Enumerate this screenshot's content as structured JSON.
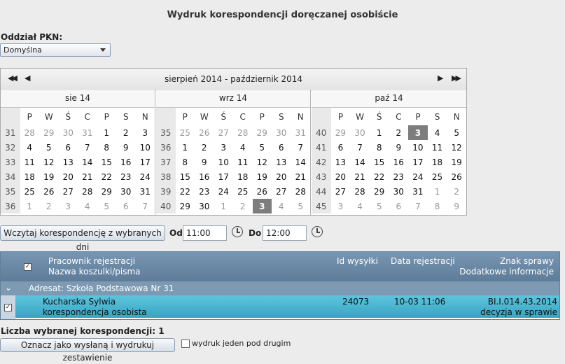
{
  "page": {
    "title": "Wydruk korespondencji doręczanej osobiście"
  },
  "branch": {
    "label": "Oddział PKN:",
    "selected": "Domyślna"
  },
  "calendar": {
    "range_label": "sierpień 2014 - październik 2014",
    "nav": {
      "first": "◀◀",
      "prev": "◀",
      "next": "▶",
      "last": "▶▶"
    },
    "weekdays": [
      "P",
      "W",
      "Ś",
      "C",
      "P",
      "S",
      "N"
    ],
    "months": [
      {
        "title": "sie 14",
        "weeks": [
          {
            "wk": "31",
            "days": [
              [
                "28",
                "o"
              ],
              [
                "29",
                "o"
              ],
              [
                "30",
                "o"
              ],
              [
                "31",
                "o"
              ],
              [
                "1",
                "c"
              ],
              [
                "2",
                "c"
              ],
              [
                "3",
                "c"
              ]
            ]
          },
          {
            "wk": "32",
            "days": [
              [
                "4",
                "c"
              ],
              [
                "5",
                "c"
              ],
              [
                "6",
                "c"
              ],
              [
                "7",
                "c"
              ],
              [
                "8",
                "c"
              ],
              [
                "9",
                "c"
              ],
              [
                "10",
                "c"
              ]
            ]
          },
          {
            "wk": "33",
            "days": [
              [
                "11",
                "c"
              ],
              [
                "12",
                "c"
              ],
              [
                "13",
                "c"
              ],
              [
                "14",
                "c"
              ],
              [
                "15",
                "c"
              ],
              [
                "16",
                "c"
              ],
              [
                "17",
                "c"
              ]
            ]
          },
          {
            "wk": "34",
            "days": [
              [
                "18",
                "c"
              ],
              [
                "19",
                "c"
              ],
              [
                "20",
                "c"
              ],
              [
                "21",
                "c"
              ],
              [
                "22",
                "c"
              ],
              [
                "23",
                "c"
              ],
              [
                "24",
                "c"
              ]
            ]
          },
          {
            "wk": "35",
            "days": [
              [
                "25",
                "c"
              ],
              [
                "26",
                "c"
              ],
              [
                "27",
                "c"
              ],
              [
                "28",
                "c"
              ],
              [
                "29",
                "c"
              ],
              [
                "30",
                "c"
              ],
              [
                "31",
                "c"
              ]
            ]
          },
          {
            "wk": "36",
            "days": [
              [
                "1",
                "o"
              ],
              [
                "2",
                "o"
              ],
              [
                "3",
                "o"
              ],
              [
                "4",
                "o"
              ],
              [
                "5",
                "o"
              ],
              [
                "6",
                "o"
              ],
              [
                "7",
                "o"
              ]
            ]
          }
        ]
      },
      {
        "title": "wrz 14",
        "weeks": [
          {
            "wk": "35",
            "days": [
              [
                "25",
                "o"
              ],
              [
                "26",
                "o"
              ],
              [
                "27",
                "o"
              ],
              [
                "28",
                "o"
              ],
              [
                "29",
                "o"
              ],
              [
                "30",
                "o"
              ],
              [
                "31",
                "o"
              ]
            ]
          },
          {
            "wk": "36",
            "days": [
              [
                "1",
                "c"
              ],
              [
                "2",
                "c"
              ],
              [
                "3",
                "c"
              ],
              [
                "4",
                "c"
              ],
              [
                "5",
                "c"
              ],
              [
                "6",
                "c"
              ],
              [
                "7",
                "c"
              ]
            ]
          },
          {
            "wk": "37",
            "days": [
              [
                "8",
                "c"
              ],
              [
                "9",
                "c"
              ],
              [
                "10",
                "c"
              ],
              [
                "11",
                "c"
              ],
              [
                "12",
                "c"
              ],
              [
                "13",
                "c"
              ],
              [
                "14",
                "c"
              ]
            ]
          },
          {
            "wk": "38",
            "days": [
              [
                "15",
                "c"
              ],
              [
                "16",
                "c"
              ],
              [
                "17",
                "c"
              ],
              [
                "18",
                "c"
              ],
              [
                "19",
                "c"
              ],
              [
                "20",
                "c"
              ],
              [
                "21",
                "c"
              ]
            ]
          },
          {
            "wk": "39",
            "days": [
              [
                "22",
                "c"
              ],
              [
                "23",
                "c"
              ],
              [
                "24",
                "c"
              ],
              [
                "25",
                "c"
              ],
              [
                "26",
                "c"
              ],
              [
                "27",
                "c"
              ],
              [
                "28",
                "c"
              ]
            ]
          },
          {
            "wk": "40",
            "days": [
              [
                "29",
                "c"
              ],
              [
                "30",
                "c"
              ],
              [
                "1",
                "o"
              ],
              [
                "2",
                "o"
              ],
              [
                "3",
                "s"
              ],
              [
                "4",
                "o"
              ],
              [
                "5",
                "o"
              ]
            ]
          }
        ]
      },
      {
        "title": "paź 14",
        "weeks": [
          {
            "wk": "40",
            "days": [
              [
                "29",
                "o"
              ],
              [
                "30",
                "o"
              ],
              [
                "1",
                "c"
              ],
              [
                "2",
                "c"
              ],
              [
                "3",
                "s"
              ],
              [
                "4",
                "c"
              ],
              [
                "5",
                "c"
              ]
            ]
          },
          {
            "wk": "41",
            "days": [
              [
                "6",
                "c"
              ],
              [
                "7",
                "c"
              ],
              [
                "8",
                "c"
              ],
              [
                "9",
                "c"
              ],
              [
                "10",
                "c"
              ],
              [
                "11",
                "c"
              ],
              [
                "12",
                "c"
              ]
            ]
          },
          {
            "wk": "42",
            "days": [
              [
                "13",
                "c"
              ],
              [
                "14",
                "c"
              ],
              [
                "15",
                "c"
              ],
              [
                "16",
                "c"
              ],
              [
                "17",
                "c"
              ],
              [
                "18",
                "c"
              ],
              [
                "19",
                "c"
              ]
            ]
          },
          {
            "wk": "43",
            "days": [
              [
                "20",
                "c"
              ],
              [
                "21",
                "c"
              ],
              [
                "22",
                "c"
              ],
              [
                "23",
                "c"
              ],
              [
                "24",
                "c"
              ],
              [
                "25",
                "c"
              ],
              [
                "26",
                "c"
              ]
            ]
          },
          {
            "wk": "44",
            "days": [
              [
                "27",
                "c"
              ],
              [
                "28",
                "c"
              ],
              [
                "29",
                "c"
              ],
              [
                "30",
                "c"
              ],
              [
                "31",
                "c"
              ],
              [
                "1",
                "o"
              ],
              [
                "2",
                "o"
              ]
            ]
          },
          {
            "wk": "45",
            "days": [
              [
                "3",
                "o"
              ],
              [
                "4",
                "o"
              ],
              [
                "5",
                "o"
              ],
              [
                "6",
                "o"
              ],
              [
                "7",
                "o"
              ],
              [
                "8",
                "o"
              ],
              [
                "9",
                "o"
              ]
            ]
          }
        ]
      }
    ]
  },
  "load": {
    "button_label": "Wczytaj korespondencję z wybranych dni",
    "from_label": "Od",
    "from_value": "11:00",
    "to_label": "Do",
    "to_value": "12:00"
  },
  "grid": {
    "header": {
      "col1_line1": "Pracownik rejestracji",
      "col1_line2": "Nazwa koszulki/pisma",
      "col2": "Id wysyłki",
      "col3": "Data rejestracji",
      "col4_line1": "Znak sprawy",
      "col4_line2": "Dodatkowe informacje"
    },
    "group_label": "Adresat: Szkoła Podstawowa Nr 31",
    "row": {
      "employee": "Kucharska Sylwia",
      "item_name": "korespondencja osobista",
      "id": "24073",
      "date": "10-03 11:06",
      "case_sign": "BI.I.014.43.2014",
      "info": "decyzja w sprawie"
    }
  },
  "footer": {
    "count_label": "Liczba wybranej korespondencji: 1",
    "mark_button": "Oznacz jako wysłaną i wydrukuj zestawienie",
    "print_option_label": "wydruk jeden pod drugim"
  },
  "colors": {
    "grid_header": "#5d7c99",
    "selected_row": "#38a5c3",
    "selected_day": "#7d7d7d"
  }
}
